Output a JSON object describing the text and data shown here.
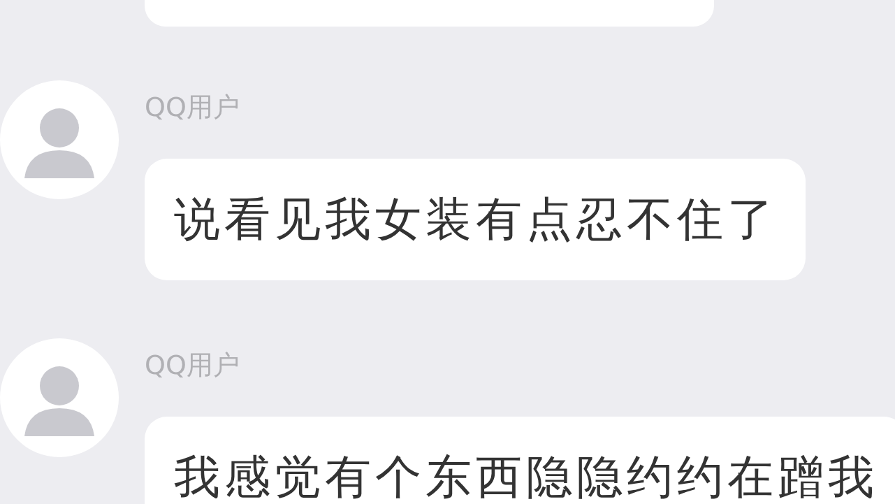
{
  "messages": [
    {
      "kind": "clipped"
    },
    {
      "kind": "text",
      "sender": "QQ用户",
      "text": "说看见我女装有点忍不住了"
    },
    {
      "kind": "text",
      "sender": "QQ用户",
      "text": "我感觉有个东西隐隐约约在蹭我"
    }
  ]
}
